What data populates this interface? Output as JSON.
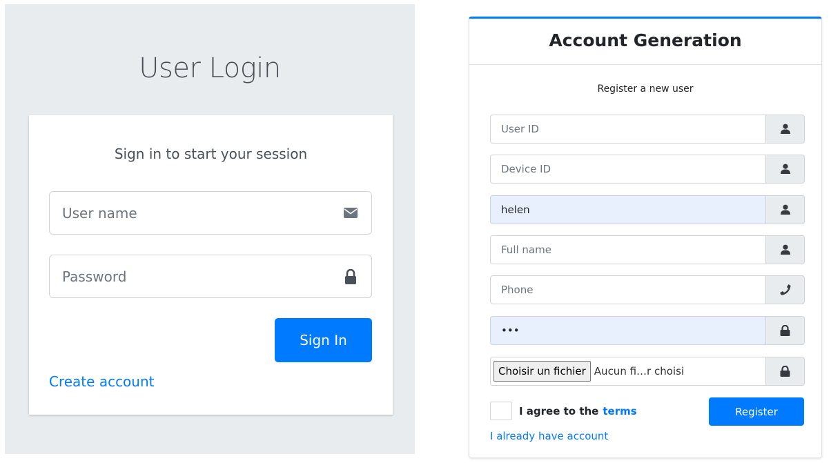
{
  "login": {
    "title": "User Login",
    "message": "Sign in to start your session",
    "username_placeholder": "User name",
    "password_placeholder": "Password",
    "signin_label": "Sign In",
    "create_account_label": "Create account",
    "icons": {
      "username": "envelope-icon",
      "password": "lock-icon"
    }
  },
  "register": {
    "title": "Account Generation",
    "message": "Register a new user",
    "fields": [
      {
        "placeholder": "User ID",
        "value": "",
        "icon": "user-icon"
      },
      {
        "placeholder": "Device ID",
        "value": "",
        "icon": "user-icon"
      },
      {
        "placeholder": "",
        "value": "helen",
        "icon": "user-icon"
      },
      {
        "placeholder": "Full name",
        "value": "",
        "icon": "user-icon"
      },
      {
        "placeholder": "Phone",
        "value": "",
        "icon": "phone-icon"
      },
      {
        "placeholder": "",
        "value": "•••",
        "icon": "lock-icon"
      }
    ],
    "file": {
      "button_label": "Choisir un fichier",
      "status": "Aucun fi…r choisi",
      "icon": "lock-icon"
    },
    "agree_text": "I agree to the",
    "terms_label": "terms",
    "register_label": "Register",
    "have_account_label": "I already have account"
  },
  "colors": {
    "primary": "#007bff",
    "panel_bg": "#e9ecef",
    "autofill_bg": "#e8f0fe"
  }
}
